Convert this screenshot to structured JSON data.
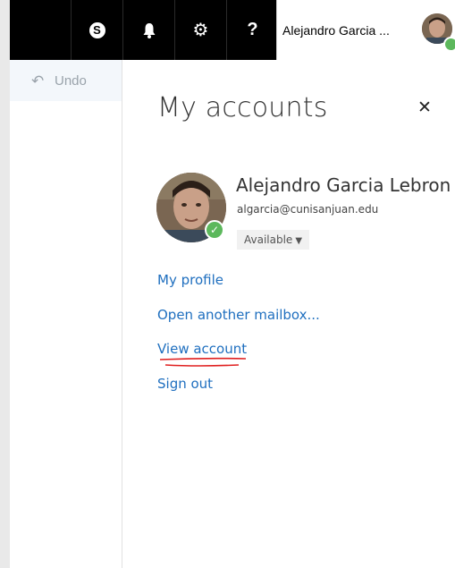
{
  "topbar": {
    "icons": [
      "skype-icon",
      "bell-icon",
      "gear-icon",
      "help-icon"
    ],
    "skype_glyph": "S",
    "bell_glyph": "🔔",
    "gear_glyph": "⚙",
    "help_glyph": "?",
    "user_name": "Alejandro Garcia ..."
  },
  "left": {
    "undo_label": "Undo"
  },
  "panel": {
    "title": "My accounts",
    "close_glyph": "✕",
    "full_name": "Alejandro Garcia Lebron",
    "email": "algarcia@cunisanjuan.edu",
    "status": "Available",
    "links": {
      "my_profile": "My profile",
      "open_mailbox": "Open another mailbox...",
      "view_account": "View account",
      "sign_out": "Sign out"
    }
  },
  "colors": {
    "link": "#1f6fbf",
    "presence": "#5cb85c",
    "annotation": "#e02020"
  }
}
